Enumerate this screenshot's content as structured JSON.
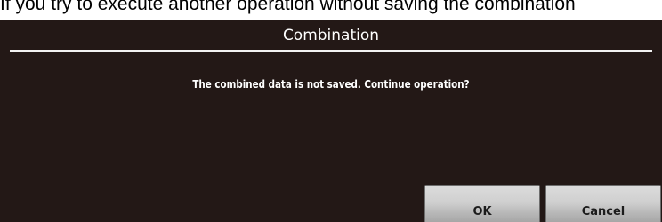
{
  "caption": "If you try to execute another operation without saving the combination",
  "dialog": {
    "title": "Combination",
    "message": "The combined data is not saved. Continue operation?",
    "buttons": {
      "ok": "OK",
      "cancel": "Cancel"
    }
  },
  "colors": {
    "dialog_background": "#231816",
    "text": "#ffffff",
    "button_face": "#cfcfcf"
  }
}
